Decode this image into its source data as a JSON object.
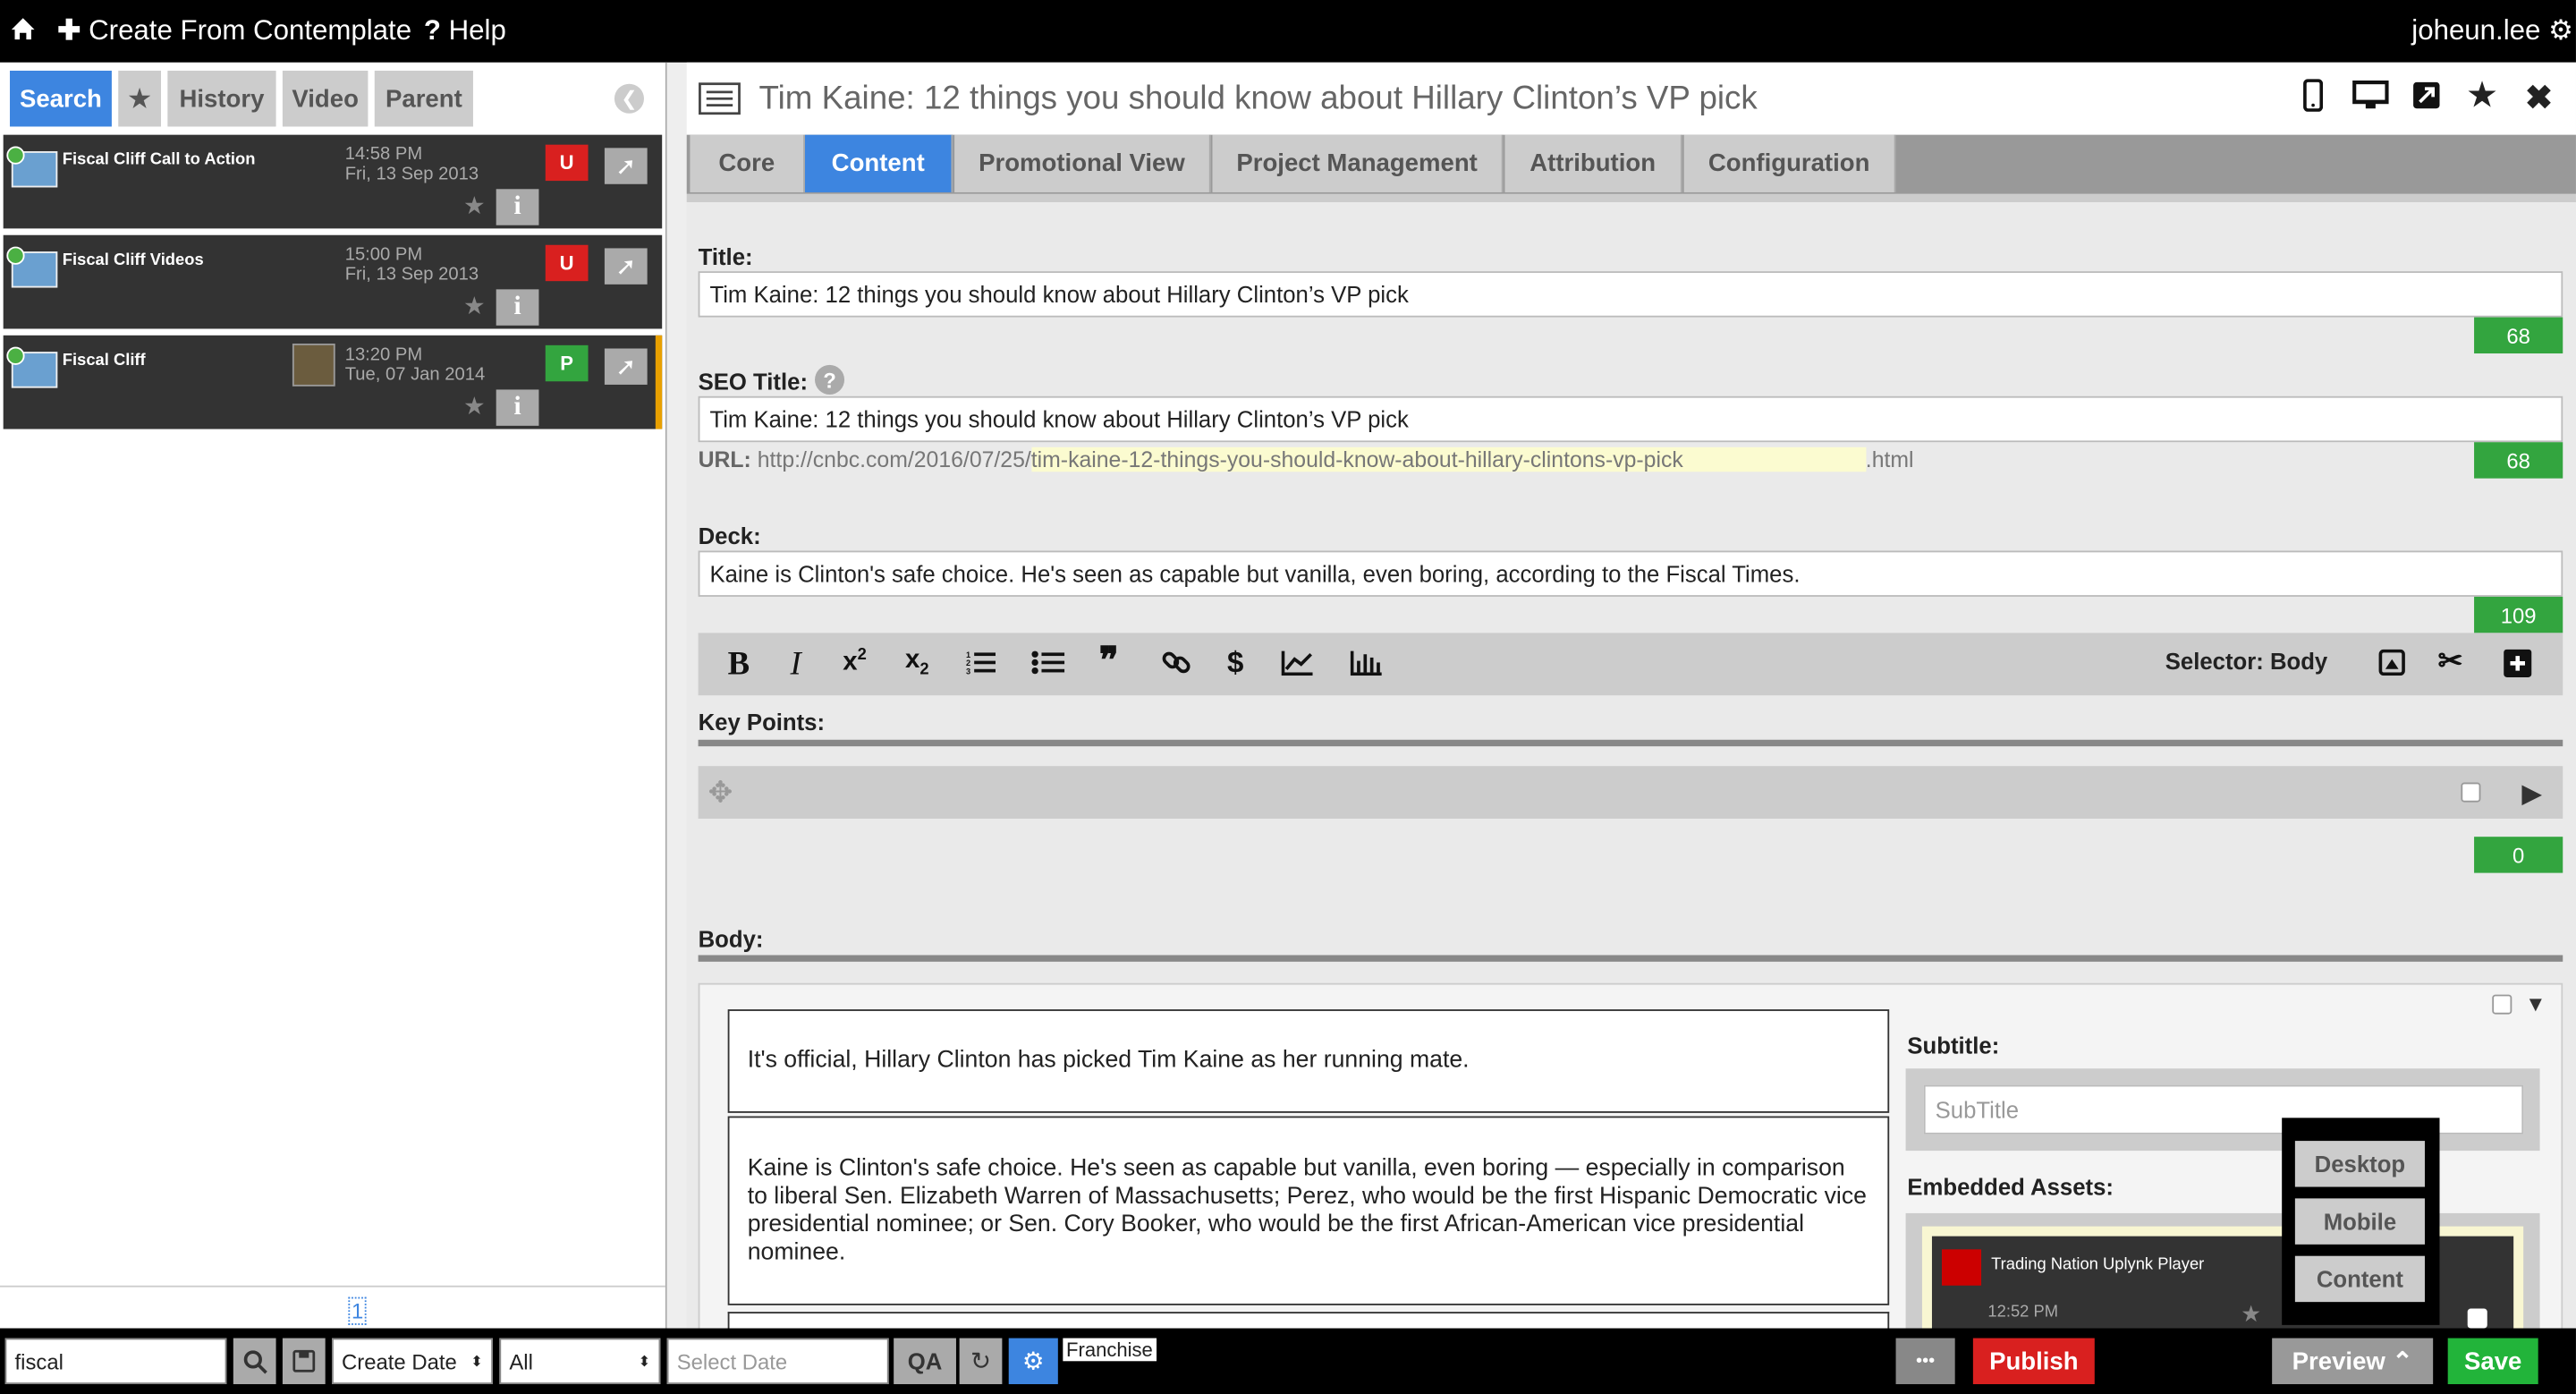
{
  "topbar": {
    "create_label": "Create From Contemplate",
    "help_label": "Help",
    "username": "joheun.lee"
  },
  "left": {
    "tabs": [
      "Search",
      "History",
      "Video",
      "Parent"
    ],
    "results": [
      {
        "title": "Fiscal Cliff Call to Action",
        "time": "14:58 PM",
        "date": "Fri, 13 Sep 2013",
        "badge": "U",
        "badge_color": "#d9201f"
      },
      {
        "title": "Fiscal Cliff Videos",
        "time": "15:00 PM",
        "date": "Fri, 13 Sep 2013",
        "badge": "U",
        "badge_color": "#d9201f"
      },
      {
        "title": "Fiscal Cliff",
        "time": "13:20 PM",
        "date": "Tue, 07 Jan 2014",
        "badge": "P",
        "badge_color": "#33a53f"
      }
    ],
    "page_number": "1"
  },
  "doc": {
    "heading": "Tim Kaine: 12 things you should know about Hillary Clinton’s VP pick",
    "tabs": [
      "Core",
      "Content",
      "Promotional View",
      "Project Management",
      "Attribution",
      "Configuration"
    ],
    "title_label": "Title:",
    "title_value": "Tim Kaine: 12 things you should know about Hillary Clinton’s VP pick",
    "title_count": "68",
    "seo_label": "SEO Title:",
    "seo_value": "Tim Kaine: 12 things you should know about Hillary Clinton’s VP pick",
    "seo_count": "68",
    "url_label": "URL:",
    "url_prefix": "http://cnbc.com/2016/07/25/",
    "url_slug": "tim-kaine-12-things-you-should-know-about-hillary-clintons-vp-pick",
    "url_suffix": ".html",
    "deck_label": "Deck:",
    "deck_value": "Kaine is Clinton's safe choice. He's seen as capable but vanilla, even boring, according to the Fiscal Times.",
    "deck_count": "109",
    "selector_label": "Selector: Body",
    "keypoints_label": "Key Points:",
    "keypoints_count": "0",
    "body_label": "Body:",
    "paragraphs": [
      "It's official, Hillary Clinton has picked Tim Kaine as her running mate.",
      "Kaine is Clinton's safe choice. He's seen as capable but vanilla, even boring — especially in comparison to liberal Sen. Elizabeth Warren of Massachusetts; Perez, who would be the first Hispanic Democratic vice presidential nominee; or Sen. Cory Booker, who would be the first African-American vice presidential nominee."
    ],
    "subtitle_label": "Subtitle:",
    "subtitle_placeholder": "SubTitle",
    "embedded_label": "Embedded Assets:",
    "asset_title": "Trading Nation Uplynk Player",
    "asset_time": "12:52 PM"
  },
  "preview_menu": [
    "Desktop",
    "Mobile",
    "Content"
  ],
  "footer": {
    "search_value": "fiscal",
    "sort_value": "Create Date",
    "filter_value": "All",
    "date_placeholder": "Select Date",
    "franchise_label": "Franchise",
    "more_label": "•••",
    "publish_label": "Publish",
    "preview_label": "Preview",
    "save_label": "Save"
  },
  "colors": {
    "accent": "#3d85e0",
    "publish": "#d9201f",
    "save": "#22b43a",
    "count": "#33a53f"
  }
}
